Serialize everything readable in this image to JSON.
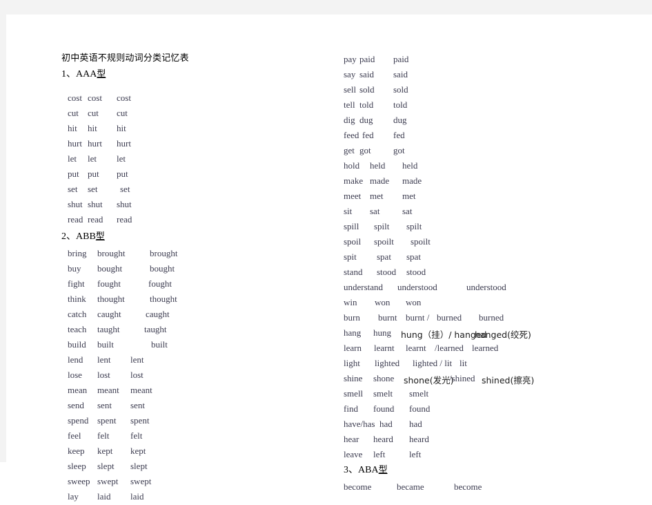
{
  "document": {
    "title": "初中英语不规则动词分类记忆表",
    "page_background": "#ffffff",
    "frame_background": "#f3f3f3",
    "text_color": "#3b3b4f"
  },
  "sections": {
    "aaa": {
      "heading_number": "1、AAA",
      "heading_suffix": "型",
      "rows": [
        {
          "c1": "cost",
          "c2": "cost",
          "c3": "cost"
        },
        {
          "c1": "cut",
          "c2": "cut",
          "c3": "cut"
        },
        {
          "c1": "hit",
          "c2": "hit",
          "c3": "hit"
        },
        {
          "c1": "hurt",
          "c2": "hurt",
          "c3": "hurt"
        },
        {
          "c1": "let",
          "c2": "let",
          "c3": "let"
        },
        {
          "c1": "put",
          "c2": "put",
          "c3": "put"
        },
        {
          "c1": "set",
          "c2": "set",
          "c3": "set"
        },
        {
          "c1": "shut",
          "c2": "shut",
          "c3": "shut"
        },
        {
          "c1": "read",
          "c2": "read",
          "c3": "read"
        }
      ]
    },
    "abb": {
      "heading_number": "2、ABB",
      "heading_suffix": "型",
      "rows_left": [
        {
          "c1": "bring",
          "c2": "brought",
          "c3": "brought"
        },
        {
          "c1": "buy",
          "c2": "bought",
          "c3": "bought"
        },
        {
          "c1": "fight",
          "c2": "fought",
          "c3": "fought"
        },
        {
          "c1": "think",
          "c2": "thought",
          "c3": "thought"
        },
        {
          "c1": "catch",
          "c2": "caught",
          "c3": "caught"
        },
        {
          "c1": "teach",
          "c2": "taught",
          "c3": "taught"
        },
        {
          "c1": "build",
          "c2": "built",
          "c3": "built"
        },
        {
          "c1": "lend",
          "c2": "lent",
          "c3": "lent"
        },
        {
          "c1": "lose",
          "c2": "lost",
          "c3": "lost"
        },
        {
          "c1": "mean",
          "c2": "meant",
          "c3": "meant"
        },
        {
          "c1": "send",
          "c2": "sent",
          "c3": "sent"
        },
        {
          "c1": "spend",
          "c2": "spent",
          "c3": "spent"
        },
        {
          "c1": "feel",
          "c2": "felt",
          "c3": "felt"
        },
        {
          "c1": "keep",
          "c2": "kept",
          "c3": "kept"
        },
        {
          "c1": "sleep",
          "c2": "slept",
          "c3": "slept"
        },
        {
          "c1": "sweep",
          "c2": "swept",
          "c3": "swept"
        },
        {
          "c1": "lay",
          "c2": "laid",
          "c3": "laid"
        }
      ],
      "rows_right": [
        {
          "c1": "pay",
          "c2": "paid",
          "c3": "paid"
        },
        {
          "c1": "say",
          "c2": "said",
          "c3": "said"
        },
        {
          "c1": "sell",
          "c2": "sold",
          "c3": "sold"
        },
        {
          "c1": "tell",
          "c2": "told",
          "c3": "told"
        },
        {
          "c1": "dig",
          "c2": "dug",
          "c3": "dug"
        },
        {
          "c1": "feed",
          "c2": "fed",
          "c3": "fed"
        },
        {
          "c1": "get",
          "c2": "got",
          "c3": "got"
        },
        {
          "c1": "hold",
          "c2": "held",
          "c3": "held"
        },
        {
          "c1": "make",
          "c2": "made",
          "c3": "made"
        },
        {
          "c1": "meet",
          "c2": "met",
          "c3": "met"
        },
        {
          "c1": "sit",
          "c2": "sat",
          "c3": "sat"
        },
        {
          "c1": "spill",
          "c2": "spilt",
          "c3": "spilt"
        },
        {
          "c1": "spoil",
          "c2": "spoilt",
          "c3": "spoilt"
        },
        {
          "c1": "spit",
          "c2": "spat",
          "c3": "spat"
        },
        {
          "c1": "stand",
          "c2": "stood",
          "c3": "stood"
        },
        {
          "c1": "understand",
          "c2": "understood",
          "c3": "understood"
        },
        {
          "c1": "win",
          "c2": "won",
          "c3": "won"
        },
        {
          "c1": "burn",
          "c2": "burnt",
          "c3": "burnt /",
          "c4": "burned",
          "c5": "burned"
        },
        {
          "c1": "hang",
          "c2": "hung",
          "c3": "hung（挂）/ hanged",
          "c5": "hanged(绞死)"
        },
        {
          "c1": "learn",
          "c2": "learnt",
          "c3": "learnt",
          "c4": "/learned",
          "c5": "learned"
        },
        {
          "c1": "light",
          "c2": "lighted",
          "c3": "lighted / lit",
          "c5": "lit"
        },
        {
          "c1": "shine",
          "c2": "shone",
          "c3": "shone(发光)",
          "c4": "/shined",
          "c5": "shined(擦亮)"
        },
        {
          "c1": "smell",
          "c2": "smelt",
          "c3": "smelt"
        },
        {
          "c1": "find",
          "c2": "found",
          "c3": "found"
        },
        {
          "c1": "have/has",
          "c2": "had",
          "c3": "had"
        },
        {
          "c1": "hear",
          "c2": "heard",
          "c3": "heard"
        },
        {
          "c1": "leave",
          "c2": "left",
          "c3": "left"
        }
      ]
    },
    "aba": {
      "heading_number": "3、ABA",
      "heading_suffix": "型",
      "rows": [
        {
          "c1": "become",
          "c2": "became",
          "c3": "become"
        }
      ]
    }
  }
}
